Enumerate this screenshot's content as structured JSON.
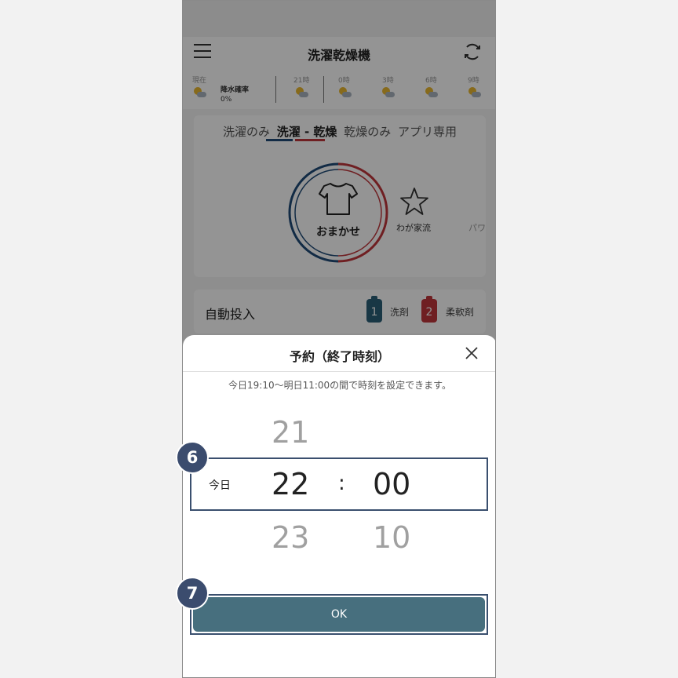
{
  "app": {
    "title": "洗濯乾燥機"
  },
  "weather": {
    "now_label": "現在",
    "rain_label": "降水確率",
    "rain_value": "0%",
    "hours": [
      "21時",
      "0時",
      "3時",
      "6時",
      "9時"
    ]
  },
  "modes": {
    "tabs": [
      "洗濯のみ",
      "洗濯 - 乾燥",
      "乾燥のみ",
      "アプリ専用"
    ],
    "active_tab": "洗濯 - 乾燥",
    "main_course": "おまかせ",
    "favorite_course": "わが家流",
    "partial_course": "パワ"
  },
  "auto_dose": {
    "label": "自動投入",
    "tank1_num": "1",
    "tank1_label": "洗剤",
    "tank2_num": "2",
    "tank2_label": "柔軟剤"
  },
  "sheet": {
    "title": "予約（終了時刻）",
    "note": "今日19:10〜明日11:00の間で時刻を設定できます。",
    "day_label": "今日",
    "hour_prev": "21",
    "hour_selected": "22",
    "hour_next": "23",
    "separator": ":",
    "minute_selected": "00",
    "minute_next": "10",
    "ok_label": "OK"
  },
  "callouts": {
    "picker_step": "6",
    "ok_step": "7"
  },
  "colors": {
    "accent_blue": "#1f4b77",
    "accent_red": "#c0363c",
    "ok_button": "#476f7e",
    "callout": "#3b4c6e",
    "tank1": "#2a5f78",
    "tank2": "#c0363c"
  }
}
